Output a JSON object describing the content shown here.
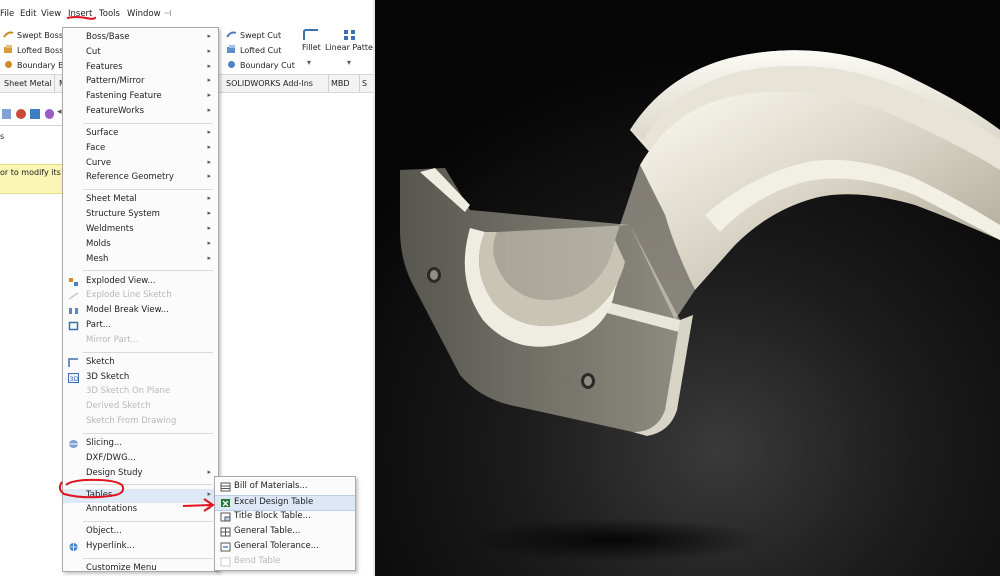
{
  "menubar": {
    "items": [
      "File",
      "Edit",
      "View",
      "Insert",
      "Tools",
      "Window"
    ],
    "pin_glyph": "⊣"
  },
  "toolbar": {
    "left_rows": [
      "Swept Boss/B",
      "Lofted Boss/B",
      "Boundary Bos"
    ],
    "right_rows": [
      "Swept Cut",
      "Lofted Cut",
      "Boundary Cut"
    ],
    "fillet_label": "Fillet",
    "linear_pattern_label": "Linear Patter"
  },
  "tabs": {
    "left": [
      "Sheet Metal",
      "M"
    ],
    "right": [
      "SOLIDWORKS Add-Ins",
      "MBD",
      "S"
    ]
  },
  "panel": {
    "title_fragment": "s",
    "message_fragment": "or to modify its"
  },
  "insert_menu": {
    "items": [
      {
        "label": "Boss/Base",
        "submenu": true,
        "disabled": false,
        "icon": "none"
      },
      {
        "label": "Cut",
        "submenu": true,
        "disabled": false,
        "icon": "none"
      },
      {
        "label": "Features",
        "submenu": true,
        "disabled": false,
        "icon": "none"
      },
      {
        "label": "Pattern/Mirror",
        "submenu": true,
        "disabled": false,
        "icon": "none"
      },
      {
        "label": "Fastening Feature",
        "submenu": true,
        "disabled": false,
        "icon": "none"
      },
      {
        "label": "FeatureWorks",
        "submenu": true,
        "disabled": false,
        "icon": "none"
      },
      {
        "label": "Surface",
        "submenu": true,
        "disabled": false,
        "icon": "none"
      },
      {
        "label": "Face",
        "submenu": true,
        "disabled": false,
        "icon": "none"
      },
      {
        "label": "Curve",
        "submenu": true,
        "disabled": false,
        "icon": "none"
      },
      {
        "label": "Reference Geometry",
        "submenu": true,
        "disabled": false,
        "icon": "none"
      },
      {
        "label": "Sheet Metal",
        "submenu": true,
        "disabled": false,
        "icon": "none"
      },
      {
        "label": "Structure System",
        "submenu": true,
        "disabled": false,
        "icon": "none"
      },
      {
        "label": "Weldments",
        "submenu": true,
        "disabled": false,
        "icon": "none"
      },
      {
        "label": "Molds",
        "submenu": true,
        "disabled": false,
        "icon": "none"
      },
      {
        "label": "Mesh",
        "submenu": true,
        "disabled": false,
        "icon": "none"
      },
      {
        "label": "Exploded View...",
        "submenu": false,
        "disabled": false,
        "icon": "exploded-view-icon"
      },
      {
        "label": "Explode Line Sketch",
        "submenu": false,
        "disabled": true,
        "icon": "explode-line-icon"
      },
      {
        "label": "Model Break View...",
        "submenu": false,
        "disabled": false,
        "icon": "model-break-icon"
      },
      {
        "label": "Part...",
        "submenu": false,
        "disabled": false,
        "icon": "part-icon"
      },
      {
        "label": "Mirror Part...",
        "submenu": false,
        "disabled": true,
        "icon": "none"
      },
      {
        "label": "Sketch",
        "submenu": false,
        "disabled": false,
        "icon": "sketch-icon"
      },
      {
        "label": "3D Sketch",
        "submenu": false,
        "disabled": false,
        "icon": "3d-sketch-icon"
      },
      {
        "label": "3D Sketch On Plane",
        "submenu": false,
        "disabled": true,
        "icon": "none"
      },
      {
        "label": "Derived Sketch",
        "submenu": false,
        "disabled": true,
        "icon": "none"
      },
      {
        "label": "Sketch From Drawing",
        "submenu": false,
        "disabled": true,
        "icon": "none"
      },
      {
        "label": "Slicing...",
        "submenu": false,
        "disabled": false,
        "icon": "slicing-icon"
      },
      {
        "label": "DXF/DWG...",
        "submenu": false,
        "disabled": false,
        "icon": "none"
      },
      {
        "label": "Design Study",
        "submenu": true,
        "disabled": false,
        "icon": "none"
      },
      {
        "label": "Tables",
        "submenu": true,
        "disabled": false,
        "icon": "none"
      },
      {
        "label": "Annotations",
        "submenu": true,
        "disabled": false,
        "icon": "none"
      },
      {
        "label": "Object...",
        "submenu": false,
        "disabled": false,
        "icon": "none"
      },
      {
        "label": "Hyperlink...",
        "submenu": false,
        "disabled": false,
        "icon": "hyperlink-icon"
      },
      {
        "label": "Customize Menu",
        "submenu": false,
        "disabled": false,
        "icon": "none"
      }
    ]
  },
  "tables_submenu": {
    "items": [
      {
        "label": "Bill of Materials...",
        "disabled": false,
        "icon": "bom-icon"
      },
      {
        "label": "Excel Design Table",
        "disabled": false,
        "icon": "excel-icon"
      },
      {
        "label": "Title Block Table...",
        "disabled": false,
        "icon": "title-block-icon"
      },
      {
        "label": "General Table...",
        "disabled": false,
        "icon": "general-table-icon"
      },
      {
        "label": "General Tolerance...",
        "disabled": false,
        "icon": "tolerance-icon"
      },
      {
        "label": "Bend Table",
        "disabled": true,
        "icon": "bend-table-icon"
      }
    ]
  },
  "colors": {
    "annotation_red": "#e0141e",
    "hover_blue": "#dde7f5",
    "tip_yellow": "#fbf6b3",
    "render_part": "#e9e6dc"
  }
}
